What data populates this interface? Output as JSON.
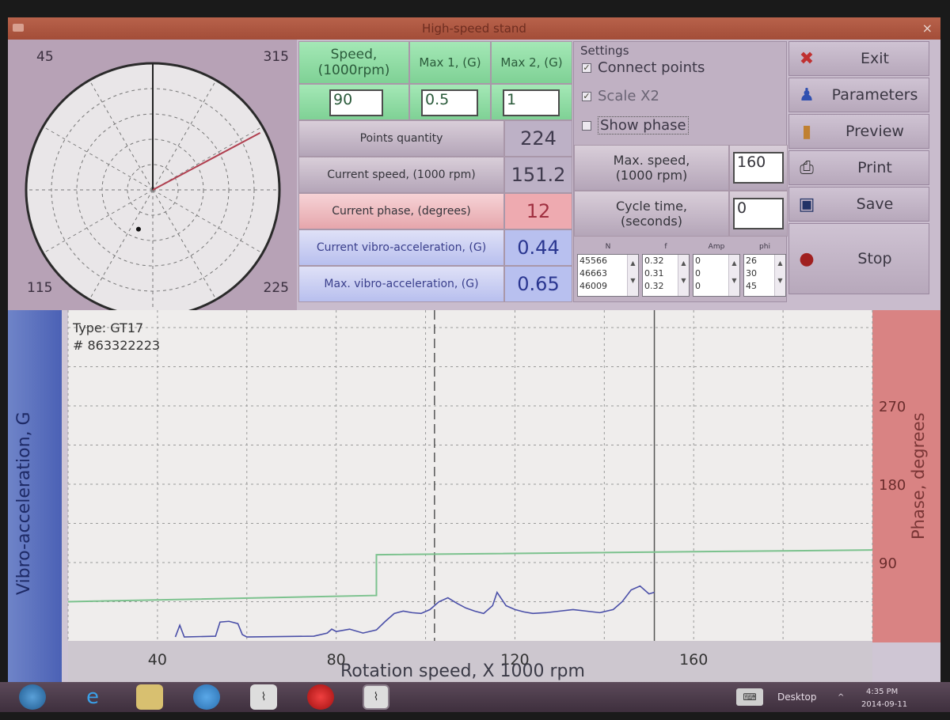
{
  "window": {
    "title": "High-speed stand",
    "close_glyph": "×"
  },
  "polar": {
    "corners": {
      "top_left": "45",
      "top_right": "315",
      "bottom_left": "115",
      "bottom_right": "225"
    },
    "pointer_angle_deg": 0,
    "phase_angle_deg": 62,
    "dot": {
      "r": 0.33,
      "angle_deg": 200
    }
  },
  "table": {
    "headers": {
      "speed": "Speed,\n(1000rpm)",
      "max1": "Max 1, (G)",
      "max2": "Max 2, (G)"
    },
    "inputs": {
      "speed": "90",
      "max1": "0.5",
      "max2": "1"
    },
    "rows": [
      {
        "label": "Points quantity",
        "value": "224",
        "style": "grey"
      },
      {
        "label": "Current speed, (1000 rpm)",
        "value": "151.2",
        "style": "grey"
      },
      {
        "label": "Current phase, (degrees)",
        "value": "12",
        "style": "pink"
      },
      {
        "label": "Current vibro-acceleration, (G)",
        "value": "0.44",
        "style": "blue"
      },
      {
        "label": "Max. vibro-acceleration, (G)",
        "value": "0.65",
        "style": "blue"
      }
    ]
  },
  "settings": {
    "title": "Settings",
    "checkboxes": [
      {
        "label": "Connect points",
        "checked": true
      },
      {
        "label": "Scale X2",
        "checked": true
      },
      {
        "label": "Show phase",
        "checked": false
      }
    ],
    "max_speed": {
      "label": "Max. speed,\n(1000 rpm)",
      "value": "160"
    },
    "cycle_time": {
      "label": "Cycle time,\n(seconds)",
      "value": "0"
    },
    "mini_table": {
      "headers": [
        "N",
        "f",
        "Amp",
        "phi"
      ],
      "columns": [
        [
          "45566",
          "46663",
          "46009"
        ],
        [
          "0.32",
          "0.31",
          "0.32"
        ],
        [
          "0",
          "0",
          "0"
        ],
        [
          "26",
          "30",
          "45"
        ]
      ]
    }
  },
  "buttons": [
    {
      "label": "Exit",
      "icon": "✖",
      "color": "#c03030"
    },
    {
      "label": "Parameters",
      "icon": "♟",
      "color": "#3050b0"
    },
    {
      "label": "Preview",
      "icon": "▮",
      "color": "#c08030"
    },
    {
      "label": "Print",
      "icon": "⎙",
      "color": "#333333"
    },
    {
      "label": "Save",
      "icon": "▣",
      "color": "#223366"
    },
    {
      "label": "Stop",
      "icon": "●",
      "color": "#a02020"
    }
  ],
  "chart_data": {
    "type": "line",
    "annotation": [
      "Type:  GT17",
      "# 863322223"
    ],
    "xlabel": "Rotation speed, X 1000 rpm",
    "ylabel": "Vibro-acceleration, G",
    "y2label": "Phase, degrees",
    "xlim": [
      20,
      200
    ],
    "ylim": [
      0,
      4
    ],
    "y2lim": [
      0,
      360
    ],
    "xticks": [
      40,
      80,
      120,
      160
    ],
    "yticks": [
      1,
      2,
      3
    ],
    "y2ticks": [
      90,
      180,
      270
    ],
    "markers": [
      {
        "x": 102,
        "style": "dashed"
      },
      {
        "x": 151.2,
        "style": "solid"
      }
    ],
    "series": [
      {
        "color": "#7cc28e",
        "points": [
          [
            20,
            0.5
          ],
          [
            89,
            0.58
          ],
          [
            89,
            1.1
          ],
          [
            200,
            1.16
          ]
        ]
      },
      {
        "color": "#4a4fa8",
        "points": [
          [
            44,
            0.05
          ],
          [
            45,
            0.2
          ],
          [
            46,
            0.05
          ],
          [
            53,
            0.06
          ],
          [
            54,
            0.24
          ],
          [
            56,
            0.25
          ],
          [
            58,
            0.22
          ],
          [
            59,
            0.08
          ],
          [
            60,
            0.05
          ],
          [
            75,
            0.06
          ],
          [
            78,
            0.1
          ],
          [
            79,
            0.15
          ],
          [
            80,
            0.12
          ],
          [
            83,
            0.15
          ],
          [
            86,
            0.1
          ],
          [
            89,
            0.14
          ],
          [
            91,
            0.25
          ],
          [
            93,
            0.35
          ],
          [
            95,
            0.38
          ],
          [
            97,
            0.36
          ],
          [
            99,
            0.35
          ],
          [
            101,
            0.4
          ],
          [
            103,
            0.5
          ],
          [
            105,
            0.55
          ],
          [
            107,
            0.48
          ],
          [
            109,
            0.42
          ],
          [
            111,
            0.38
          ],
          [
            113,
            0.35
          ],
          [
            115,
            0.45
          ],
          [
            116,
            0.62
          ],
          [
            118,
            0.45
          ],
          [
            120,
            0.4
          ],
          [
            122,
            0.37
          ],
          [
            124,
            0.35
          ],
          [
            127,
            0.36
          ],
          [
            130,
            0.38
          ],
          [
            133,
            0.4
          ],
          [
            136,
            0.38
          ],
          [
            139,
            0.36
          ],
          [
            142,
            0.4
          ],
          [
            144,
            0.5
          ],
          [
            146,
            0.65
          ],
          [
            148,
            0.7
          ],
          [
            150,
            0.6
          ],
          [
            151.2,
            0.62
          ]
        ]
      }
    ]
  },
  "taskbar": {
    "desktop_label": "Desktop",
    "time": "4:35 PM",
    "date": "2014-09-11"
  }
}
